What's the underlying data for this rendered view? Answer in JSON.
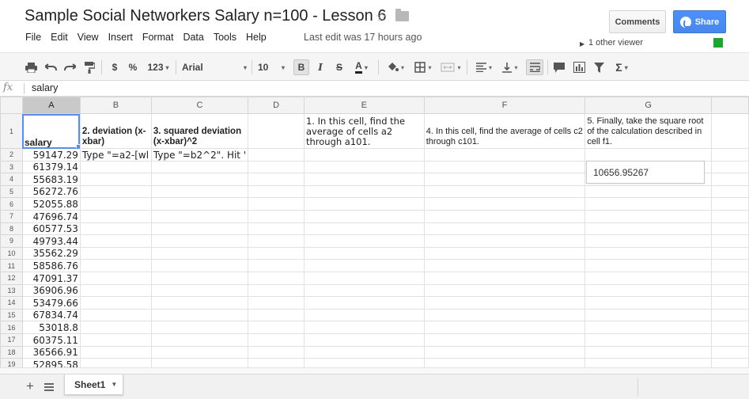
{
  "document": {
    "title": "Sample Social Networkers Salary n=100 - Lesson 6",
    "last_edit": "Last edit was 17 hours ago",
    "viewers": "1 other viewer"
  },
  "menu": [
    "File",
    "Edit",
    "View",
    "Insert",
    "Format",
    "Data",
    "Tools",
    "Help"
  ],
  "buttons": {
    "comments": "Comments",
    "share": "Share"
  },
  "toolbar": {
    "currency": "$",
    "percent": "%",
    "number_format": "123",
    "font": "Arial",
    "font_size": "10",
    "bold": "B",
    "italic": "I",
    "strike": "S",
    "text_color": "A",
    "sum": "Σ"
  },
  "formula_bar": {
    "fx": "fx",
    "value": "salary"
  },
  "columns": [
    "A",
    "B",
    "C",
    "D",
    "E",
    "F",
    "G"
  ],
  "row_numbers": [
    "1",
    "2",
    "3",
    "4",
    "5",
    "6",
    "7",
    "8",
    "9",
    "10",
    "11",
    "12",
    "13",
    "14",
    "15",
    "16",
    "17",
    "18",
    "19"
  ],
  "row1": {
    "A": "salary",
    "B": "2. deviation (x-xbar)",
    "C": "3. squared deviation (x-xbar)^2",
    "D": "",
    "E": "1. In this cell, find the average of cells a2 through a101.",
    "F": "4. In this cell, find the average of cells c2 through c101.",
    "G": "5. Finally, take the square root of the calculation described in cell f1."
  },
  "row2_extra": {
    "B": "Type \"=a2-[wl",
    "C": "Type \"=b2^2\". Hit '"
  },
  "salaries": [
    "59147.29",
    "61379.14",
    "55683.19",
    "56272.76",
    "52055.88",
    "47696.74",
    "60577.53",
    "49793.44",
    "35562.29",
    "58586.76",
    "47091.37",
    "36906.96",
    "53479.66",
    "67834.74",
    "53018.8",
    "60375.11",
    "36566.91",
    "52895.58"
  ],
  "popup_value": "10656.95267",
  "sheet": {
    "name": "Sheet1"
  },
  "colors": {
    "share_blue": "#4d90fe",
    "selection_blue": "#4d90fe",
    "viewer_green": "#1aa82c"
  }
}
